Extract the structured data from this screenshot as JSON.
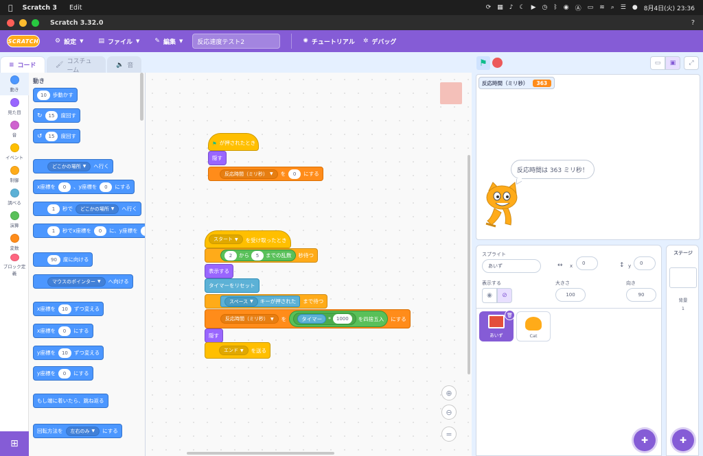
{
  "mac_menu": {
    "app_name": "Scratch 3",
    "edit": "Edit",
    "date_time": "8月4日(火) 23:36"
  },
  "window": {
    "title": "Scratch 3.32.0"
  },
  "scratch_menu": {
    "logo": "SCRATCH",
    "settings": "設定",
    "file": "ファイル",
    "edit": "編集",
    "project_name": "反応速度テスト2",
    "tutorial": "チュートリアル",
    "debug": "デバッグ"
  },
  "tabs": {
    "code": "コード",
    "costume": "コスチューム",
    "sound": "音"
  },
  "categories": [
    {
      "label": "動き",
      "color": "#4c97ff"
    },
    {
      "label": "見た目",
      "color": "#9966ff"
    },
    {
      "label": "音",
      "color": "#cf63cf"
    },
    {
      "label": "イベント",
      "color": "#ffbf00"
    },
    {
      "label": "制御",
      "color": "#ffab19"
    },
    {
      "label": "調べる",
      "color": "#5cb1d6"
    },
    {
      "label": "演算",
      "color": "#59c059"
    },
    {
      "label": "変数",
      "color": "#ff8c1a"
    },
    {
      "label": "ブロック定義",
      "color": "#ff6680"
    }
  ],
  "palette": {
    "heading": "動き",
    "move": {
      "v": "10",
      "t": "歩動かす"
    },
    "turn_right": {
      "v": "15",
      "t": "度回す"
    },
    "turn_left": {
      "v": "15",
      "t": "度回す"
    },
    "goto": {
      "d": "どこかの場所",
      "t": "へ行く"
    },
    "goxy": {
      "a": "x座標を",
      "x": "0",
      "b": "、y座標を",
      "y": "0",
      "c": "にする"
    },
    "glide": {
      "v": "1",
      "a": "秒で",
      "d": "どこかの場所",
      "t": "へ行く"
    },
    "glidexy": {
      "v": "1",
      "a": "秒でx座標を",
      "x": "0",
      "b": "に、y座標を",
      "y": "0"
    },
    "point": {
      "v": "90",
      "t": "度に向ける"
    },
    "pointto": {
      "d": "マウスのポインター",
      "t": "へ向ける"
    },
    "changex": {
      "a": "x座標を",
      "v": "10",
      "t": "ずつ変える"
    },
    "setx": {
      "a": "x座標を",
      "v": "0",
      "t": "にする"
    },
    "changey": {
      "a": "y座標を",
      "v": "10",
      "t": "ずつ変える"
    },
    "sety": {
      "a": "y座標を",
      "v": "0",
      "t": "にする"
    },
    "bounce": "もし端に着いたら、跳ね返る",
    "rotstyle": {
      "a": "回転方法を",
      "d": "左右のみ",
      "t": "にする"
    }
  },
  "script1": {
    "hat": "が押されたとき",
    "hide": "隠す",
    "setvar": {
      "d": "反応時間（ミリ秒）",
      "a": "を",
      "v": "0",
      "t": "にする"
    }
  },
  "script2": {
    "hat": {
      "d": "スタート",
      "t": "を受け取ったとき"
    },
    "wait": {
      "a": "2",
      "b": "から",
      "c": "5",
      "d": "までの乱数",
      "t": "秒待つ"
    },
    "show": "表示する",
    "reset": "タイマーをリセット",
    "waituntil": {
      "d": "スペース",
      "a": "キーが押された",
      "t": "まで待つ"
    },
    "setvar": {
      "d": "反応時間（ミリ秒）",
      "a": "を",
      "timer": "タイマー",
      "op": "*",
      "v": "1000",
      "r": "を四捨五入",
      "t": "にする"
    },
    "hide": "隠す",
    "broadcast": {
      "d": "エンド",
      "t": "を送る"
    }
  },
  "stage": {
    "monitor_label": "反応時間（ミリ秒）",
    "monitor_value": "363",
    "bubble": "反応時間は 363 ミリ秒！"
  },
  "sprite_info": {
    "sprite_label": "スプライト",
    "sprite_name": "あいず",
    "x_label": "x",
    "x": "0",
    "y_label": "y",
    "y": "0",
    "show_label": "表示する",
    "size_label": "大きさ",
    "size": "100",
    "dir_label": "向き",
    "direction": "90"
  },
  "sprites": [
    {
      "name": "あいず",
      "selected": true
    },
    {
      "name": "Cat",
      "selected": false
    }
  ],
  "stage_pane": {
    "title": "ステージ",
    "bg_label": "背景",
    "bg_count": "1"
  }
}
